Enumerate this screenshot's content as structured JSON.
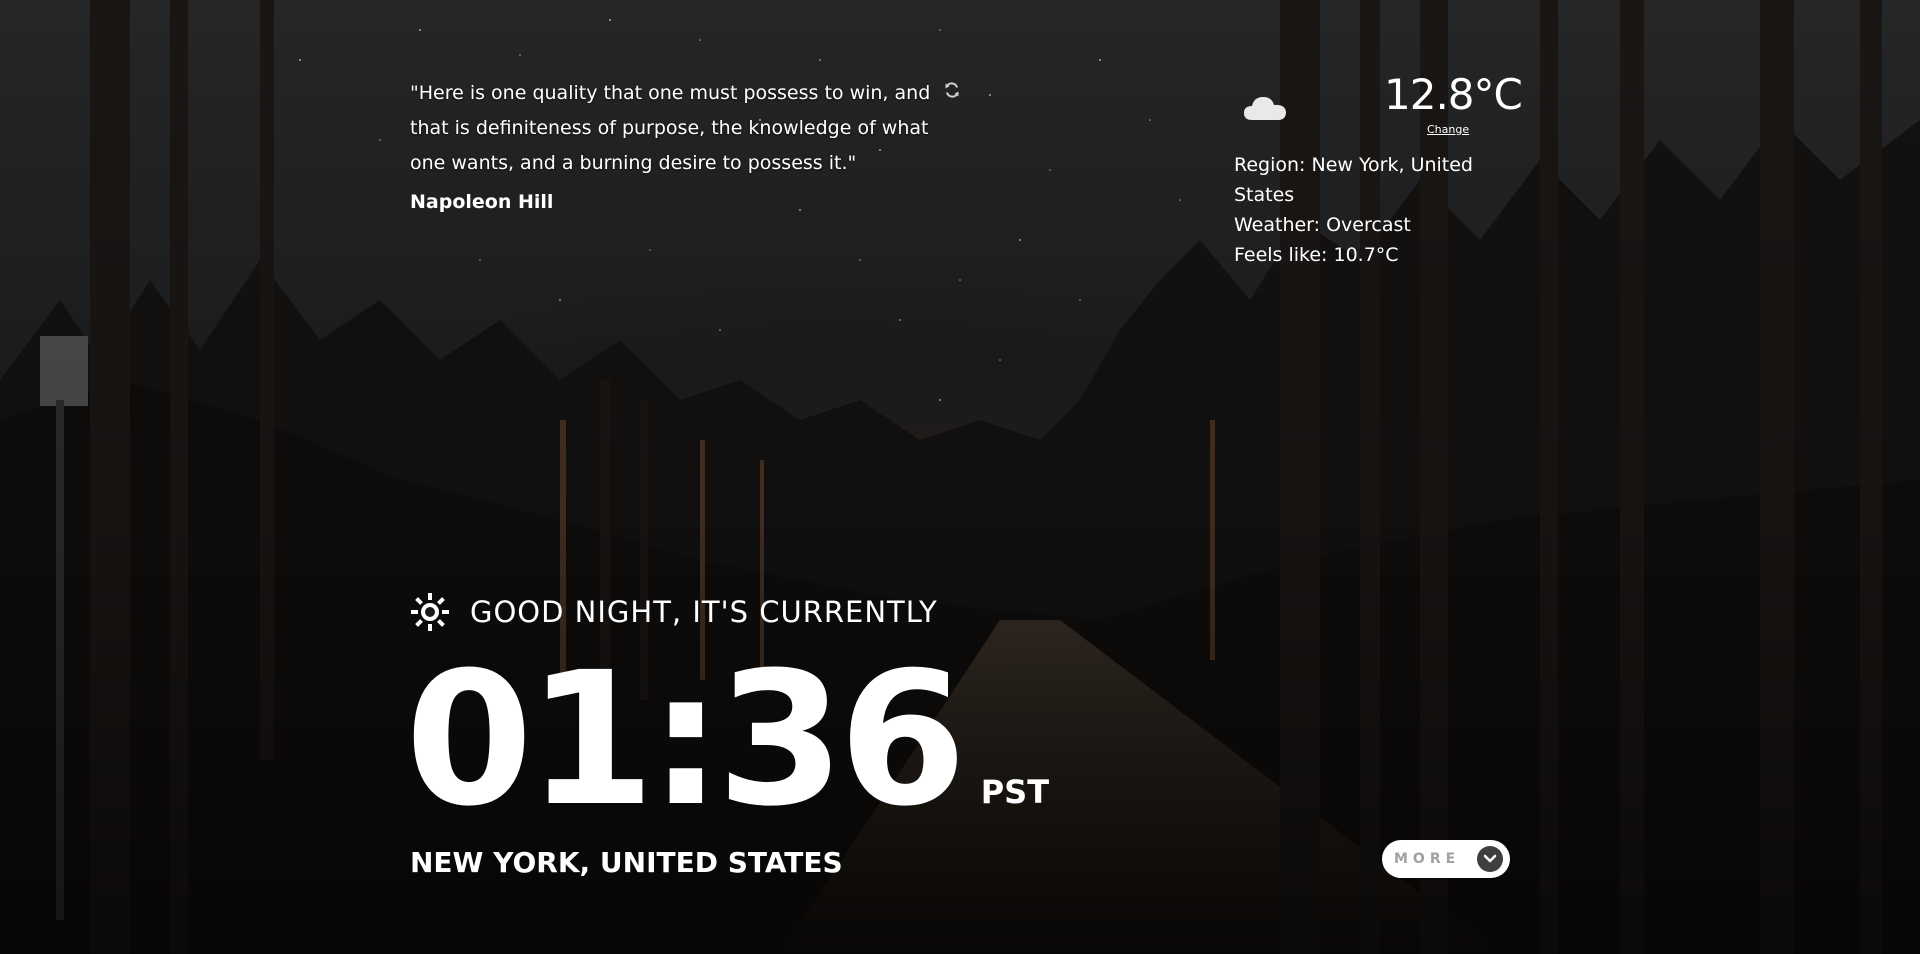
{
  "quote": {
    "text": "\"Here is one quality that one must possess to win, and that is definiteness of purpose, the knowledge of what one wants, and a burning desire to possess it.\"",
    "author": "Napoleon Hill",
    "refresh_icon": "refresh-icon"
  },
  "weather": {
    "icon": "cloud-icon",
    "temperature": "12.8°C",
    "change_label": "Change",
    "region": "Region: New York, United States",
    "condition": "Weather: Overcast",
    "feels_like": "Feels like: 10.7°C"
  },
  "greeting": {
    "icon": "sun-icon",
    "text": "GOOD NIGHT, IT'S CURRENTLY"
  },
  "clock": {
    "time": "01:36",
    "timezone": "PST",
    "location": "NEW YORK, UNITED STATES"
  },
  "more_button": {
    "label": "MORE",
    "icon": "chevron-down-icon"
  }
}
